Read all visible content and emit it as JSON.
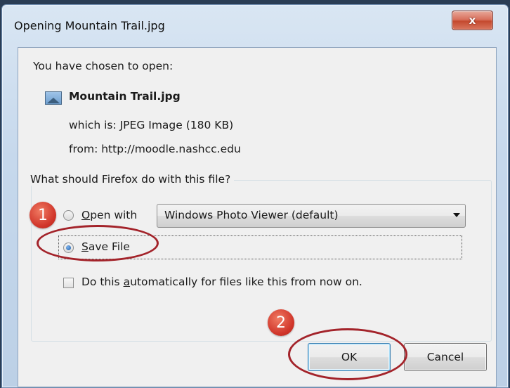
{
  "dialog": {
    "title": "Opening Mountain Trail.jpg",
    "close_glyph": "x",
    "intro": "You have chosen to open:",
    "file_name": "Mountain Trail.jpg",
    "which_is": "which is:  JPEG Image (180 KB)",
    "from": "from:  http://moodle.nashcc.edu",
    "question": "What should Firefox do with this file?",
    "open_with": {
      "accel": "O",
      "rest": "pen with",
      "selected": false
    },
    "app_select": {
      "value": "Windows Photo Viewer (default)"
    },
    "save_file": {
      "accel": "S",
      "rest": "ave File",
      "selected": true
    },
    "auto_checkbox": {
      "before": "Do this ",
      "accel": "a",
      "after": "utomatically for files like this from now on.",
      "checked": false
    },
    "ok_label": "OK",
    "cancel_label": "Cancel"
  },
  "annotations": {
    "step1": "1",
    "step2": "2",
    "color": "#c0282d"
  },
  "icons": [
    "close-icon",
    "image-file-icon",
    "dropdown-arrow-icon"
  ]
}
